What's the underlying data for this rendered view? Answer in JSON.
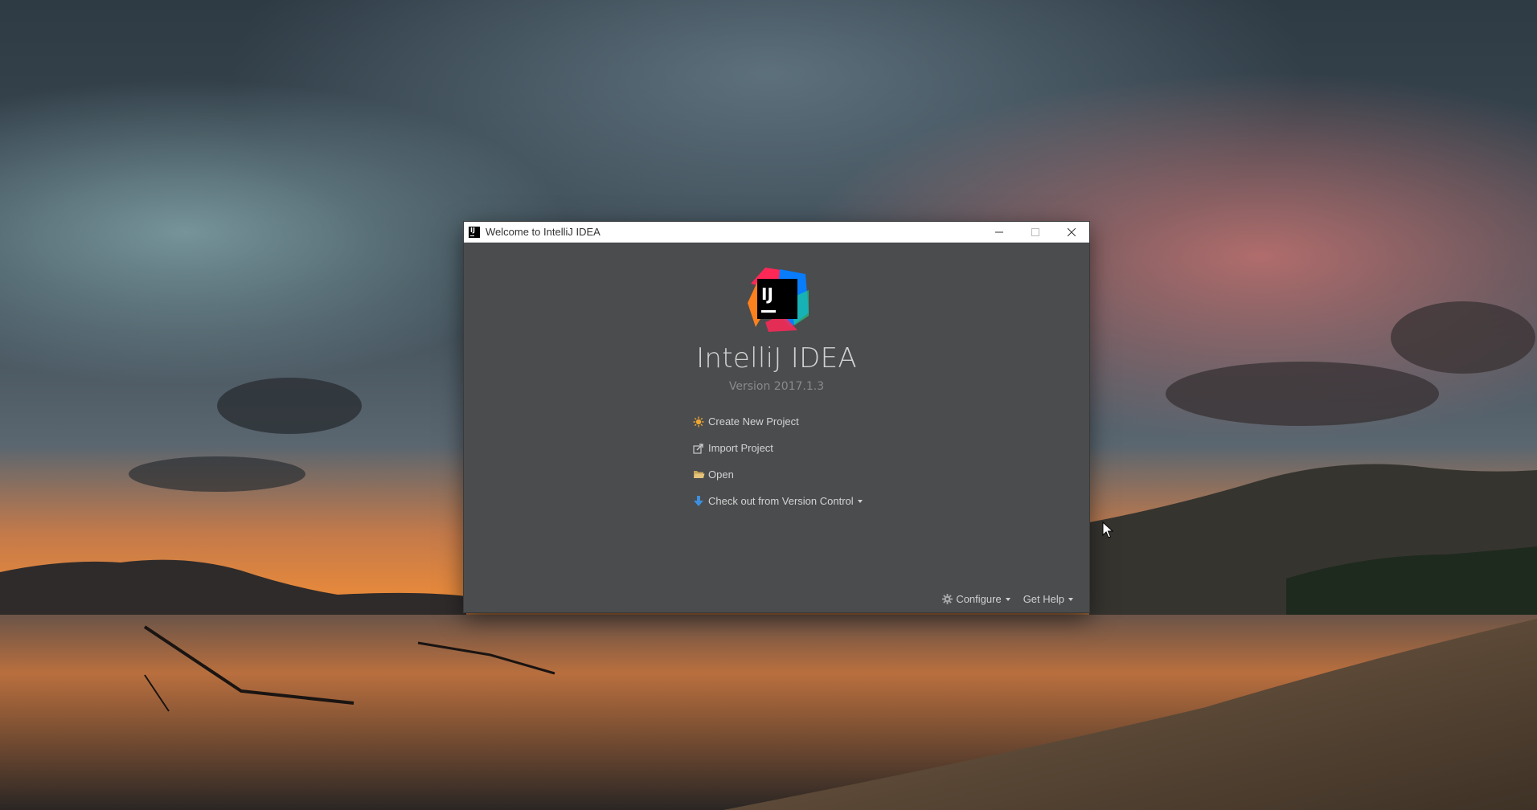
{
  "window": {
    "title": "Welcome to IntelliJ IDEA",
    "controls": [
      "minimize-icon",
      "maximize-icon",
      "close-icon"
    ]
  },
  "welcome": {
    "logo_text": "IJ",
    "product_name": "IntelliJ IDEA",
    "version": "Version 2017.1.3"
  },
  "actions": [
    {
      "label": "Create New Project",
      "icon": "sun-icon"
    },
    {
      "label": "Import Project",
      "icon": "import-icon"
    },
    {
      "label": "Open",
      "icon": "folder-icon"
    },
    {
      "label": "Check out from Version Control",
      "icon": "download-icon"
    }
  ],
  "bottom": {
    "configure_label": "Configure",
    "help_label": "Get Help"
  },
  "colors": {
    "window_bg": "#4a4c4e",
    "title_text": "#d2d2d2",
    "version_text": "#8a8a8a",
    "action_text": "#d3d3d3"
  }
}
